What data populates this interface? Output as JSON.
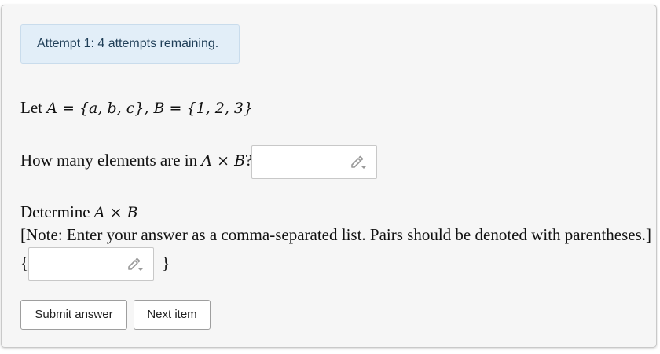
{
  "attempt": {
    "label": "Attempt 1: 4 attempts remaining."
  },
  "problem": {
    "intro_text": "Let",
    "set_a_def": "A = {a, b, c}",
    "separator": ", ",
    "set_b_def": "B = {1, 2, 3}",
    "q1_text": "How many elements are in",
    "q1_math": "A × B",
    "q1_suffix": "?",
    "q1_answer_value": "",
    "q2_text": "Determine",
    "q2_math": "A × B",
    "q2_note": "[Note: Enter your answer as a comma-separated list. Pairs should be denoted with parentheses.]",
    "q2_open_brace": "{",
    "q2_close_brace": "}",
    "q2_answer_value": ""
  },
  "buttons": {
    "submit_label": "Submit answer",
    "next_label": "Next item"
  },
  "icons": {
    "input_tool": "pencil-dropdown-icon"
  }
}
